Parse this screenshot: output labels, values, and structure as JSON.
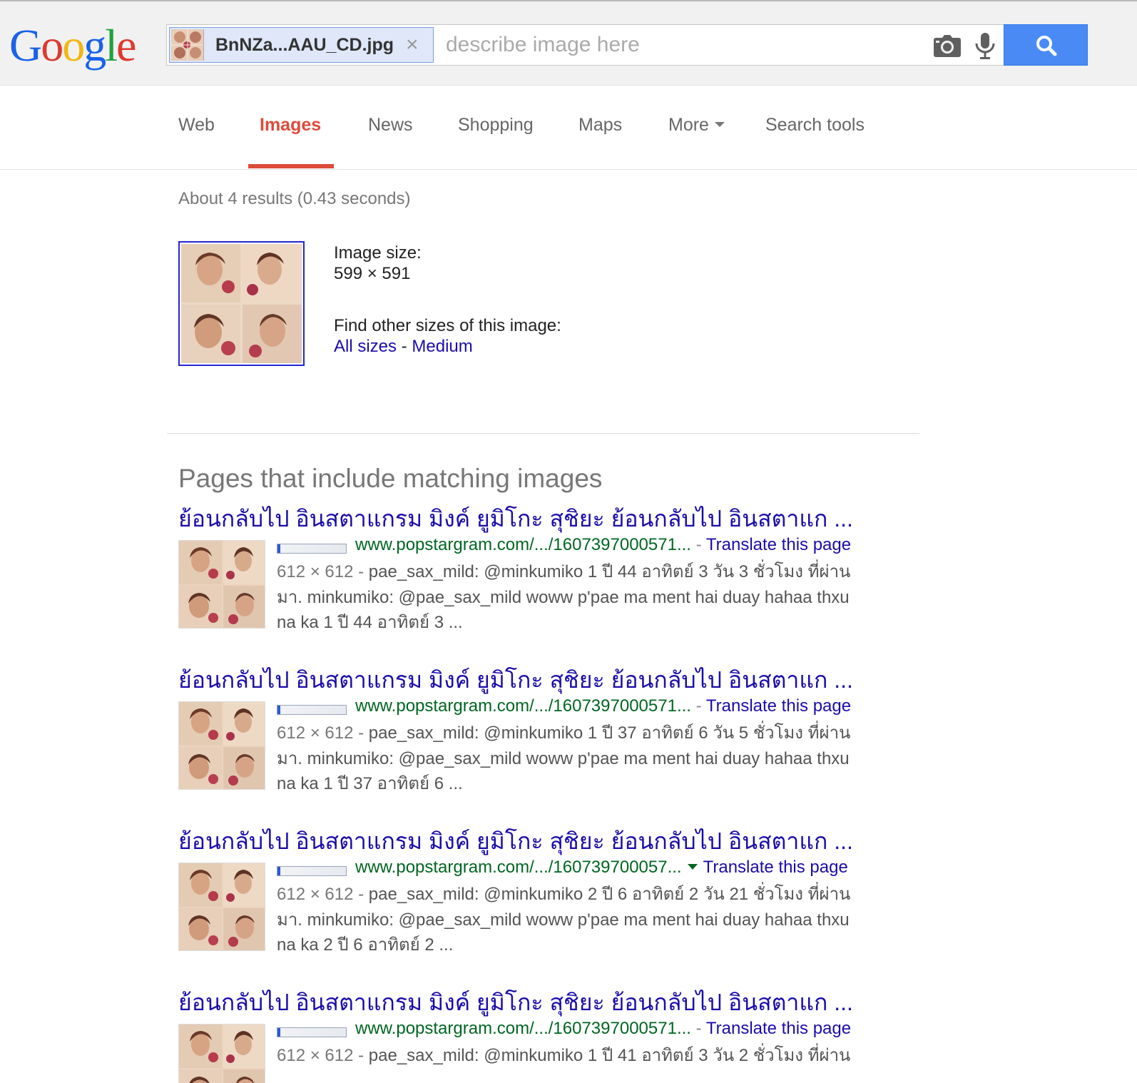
{
  "logo": {
    "letters": [
      {
        "ch": "G",
        "color": "#1a62e8"
      },
      {
        "ch": "o",
        "color": "#dd3a2e"
      },
      {
        "ch": "o",
        "color": "#f1b711"
      },
      {
        "ch": "g",
        "color": "#1a62e8"
      },
      {
        "ch": "l",
        "color": "#1fa23d"
      },
      {
        "ch": "e",
        "color": "#dd3a2e"
      }
    ]
  },
  "search": {
    "file_name": "BnNZa...AAU_CD.jpg",
    "remove_label": "×",
    "placeholder": "describe image here",
    "value": ""
  },
  "nav": {
    "tabs": [
      {
        "label": "Web"
      },
      {
        "label": "Images"
      },
      {
        "label": "News"
      },
      {
        "label": "Shopping"
      },
      {
        "label": "Maps"
      },
      {
        "label": "More"
      },
      {
        "label": "Search tools"
      }
    ],
    "active": "Images"
  },
  "stats": "About 4 results (0.43 seconds)",
  "image_info": {
    "size_label": "Image size:",
    "size_value": "599 × 591",
    "other_sizes_label": "Find other sizes of this image:",
    "all_sizes": "All sizes",
    "separator": "-",
    "medium": "Medium"
  },
  "section_title": "Pages that include matching images",
  "results": [
    {
      "title": "ย้อนกลับไป อินสตาแกรม มิงค์ ยูมิโกะ สุชิยะ ย้อนกลับไป อินสตาแก ...",
      "url": "www.popstargram.com/.../1607397000571...",
      "url_sep": "-",
      "translate": "Translate this page",
      "dims": "612 × 612",
      "snippet_dash": "-",
      "snippet_l1": "pae_sax_mild: @minkumiko 1 ปี 44 อาทิตย์ 3 วัน 3 ชั่วโมง ที่ผ่าน",
      "snippet_l2": "มา. minkumiko: @pae_sax_mild woww p'pae ma ment hai duay hahaa thxu",
      "snippet_l3": "na ka 1 ปี 44 อาทิตย์ 3 ..."
    },
    {
      "title": "ย้อนกลับไป อินสตาแกรม มิงค์ ยูมิโกะ สุชิยะ ย้อนกลับไป อินสตาแก ...",
      "url": "www.popstargram.com/.../1607397000571...",
      "url_sep": "-",
      "translate": "Translate this page",
      "dims": "612 × 612",
      "snippet_dash": "-",
      "snippet_l1": "pae_sax_mild: @minkumiko 1 ปี 37 อาทิตย์ 6 วัน 5 ชั่วโมง ที่ผ่าน",
      "snippet_l2": "มา. minkumiko: @pae_sax_mild woww p'pae ma ment hai duay hahaa thxu",
      "snippet_l3": "na ka 1 ปี 37 อาทิตย์ 6 ..."
    },
    {
      "title": "ย้อนกลับไป อินสตาแกรม มิงค์ ยูมิโกะ สุชิยะ ย้อนกลับไป อินสตาแก ...",
      "url": "www.popstargram.com/.../160739700057...",
      "url_sep": "",
      "translate": "Translate this page",
      "dims": "612 × 612",
      "snippet_dash": "-",
      "snippet_l1": "pae_sax_mild: @minkumiko 2 ปี 6 อาทิตย์ 2 วัน 21 ชั่วโมง ที่ผ่าน",
      "snippet_l2": "มา. minkumiko: @pae_sax_mild woww p'pae ma ment hai duay hahaa thxu",
      "snippet_l3": "na ka 2 ปี 6 อาทิตย์ 2 ..."
    },
    {
      "title": "ย้อนกลับไป อินสตาแกรม มิงค์ ยูมิโกะ สุชิยะ ย้อนกลับไป อินสตาแก ...",
      "url": "www.popstargram.com/.../1607397000571...",
      "url_sep": "-",
      "translate": "Translate this page",
      "dims": "612 × 612",
      "snippet_dash": "-",
      "snippet_l1": "pae_sax_mild: @minkumiko 1 ปี 41 อาทิตย์ 3 วัน 2 ชั่วโมง ที่ผ่าน",
      "snippet_l2": "",
      "snippet_l3": ""
    }
  ],
  "colors": {
    "accent_red": "#dd4b39",
    "search_blue": "#4a8af4",
    "link_blue": "#1a0dab",
    "url_green": "#006621"
  }
}
